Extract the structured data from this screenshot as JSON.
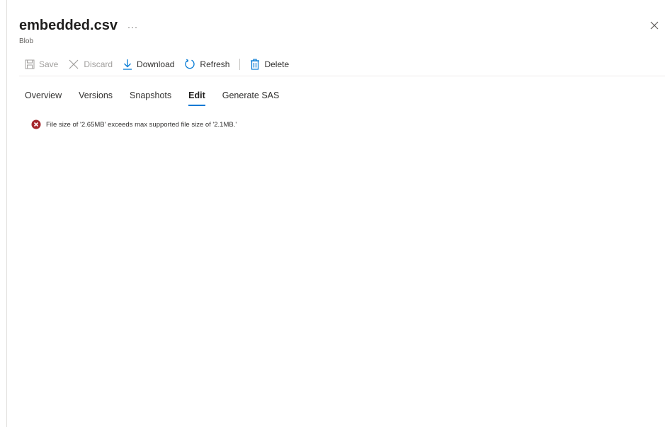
{
  "header": {
    "title": "embedded.csv",
    "more_icon": "···",
    "subtitle": "Blob",
    "close_icon": "close-icon"
  },
  "toolbar": {
    "save_label": "Save",
    "discard_label": "Discard",
    "download_label": "Download",
    "refresh_label": "Refresh",
    "delete_label": "Delete"
  },
  "tabs": [
    {
      "label": "Overview"
    },
    {
      "label": "Versions"
    },
    {
      "label": "Snapshots"
    },
    {
      "label": "Edit",
      "active": true
    },
    {
      "label": "Generate SAS"
    }
  ],
  "error": {
    "message": "File size of '2.65MB' exceeds max supported file size of '2.1MB.'"
  },
  "colors": {
    "accent": "#0078d4",
    "error": "#a4262c",
    "disabled_text": "#a19f9d"
  }
}
